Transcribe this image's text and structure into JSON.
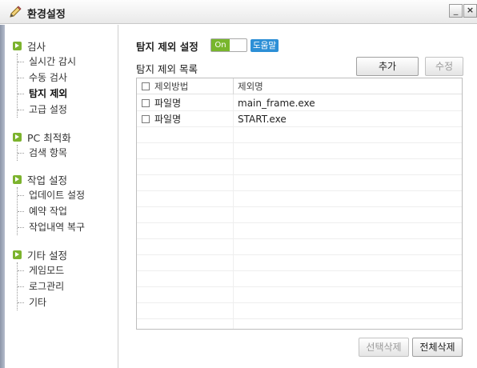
{
  "window": {
    "title": "환경설정",
    "min_label": "_",
    "close_label": "×"
  },
  "sidebar": {
    "groups": [
      {
        "title": "검사",
        "items": [
          "실시간 감시",
          "수동 검사",
          "탐지 제외",
          "고급 설정"
        ]
      },
      {
        "title": "PC 최적화",
        "items": [
          "검색 항목"
        ]
      },
      {
        "title": "작업 설정",
        "items": [
          "업데이트 설정",
          "예약 작업",
          "작업내역 복구"
        ]
      },
      {
        "title": "기타 설정",
        "items": [
          "게임모드",
          "로그관리",
          "기타"
        ]
      }
    ],
    "active_item": "탐지 제외"
  },
  "main": {
    "heading": "탐지 제외 설정",
    "toggle_label": "On",
    "help_label": "도움말",
    "list_label": "탐지 제외 목록",
    "add_button": "추가",
    "edit_button": "수정",
    "table": {
      "columns": [
        "제외방법",
        "제외명"
      ],
      "rows": [
        {
          "method": "파일명",
          "name": "main_frame.exe"
        },
        {
          "method": "파일명",
          "name": "START.exe"
        }
      ]
    },
    "delete_selected_button": "선택삭제",
    "delete_all_button": "전체삭제"
  },
  "colors": {
    "accent_green": "#78b62c",
    "help_blue": "#2c8fd6"
  }
}
